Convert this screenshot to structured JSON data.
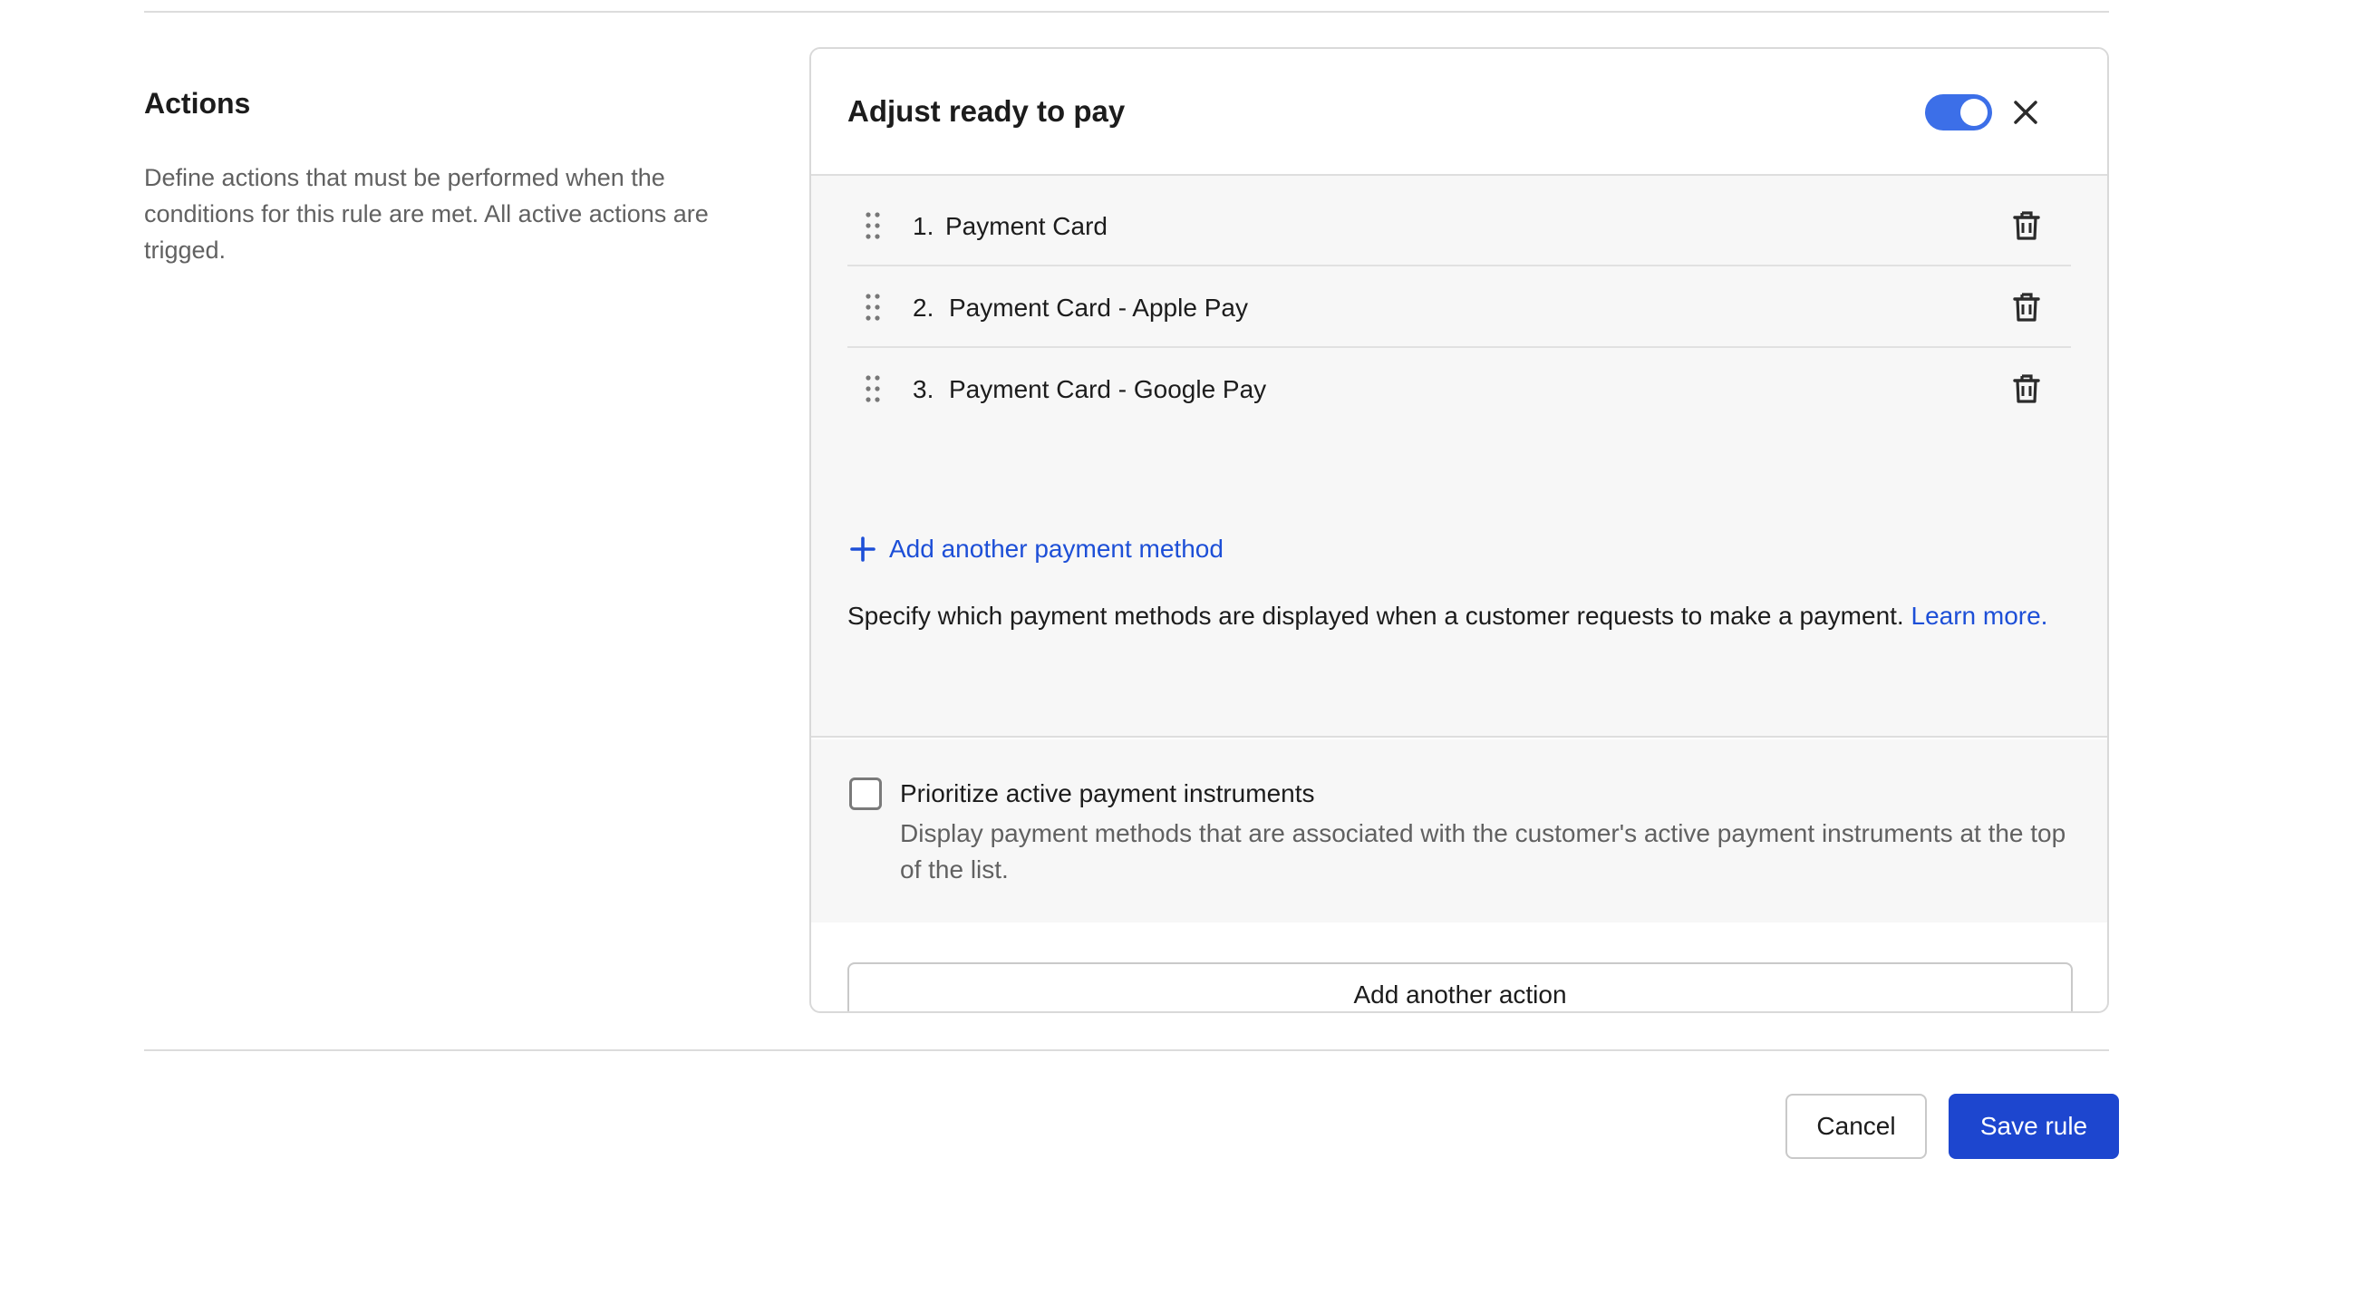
{
  "section": {
    "title": "Actions",
    "description": "Define actions that must be performed when the conditions for this rule are met. All active actions are trigged."
  },
  "action_card": {
    "title": "Adjust ready to pay",
    "toggle_on": true,
    "payment_methods": [
      {
        "number": "1.",
        "name": "Payment Card"
      },
      {
        "number": "2.",
        "name": "Payment Card - Apple Pay"
      },
      {
        "number": "3.",
        "name": "Payment Card - Google Pay"
      }
    ],
    "add_method_label": "Add another payment method",
    "help_text": "Specify which payment methods are displayed when a customer requests to make a payment.",
    "learn_more": "Learn more.",
    "prioritize": {
      "checked": false,
      "label": "Prioritize active payment instruments",
      "description": "Display payment methods that are associated with the customer's active payment instruments at the top of the list."
    },
    "add_action_label": "Add another action"
  },
  "footer": {
    "cancel_label": "Cancel",
    "save_label": "Save rule"
  },
  "colors": {
    "accent": "#1d46cf",
    "link": "#1d4fd7",
    "toggle": "#3c6fe8"
  }
}
